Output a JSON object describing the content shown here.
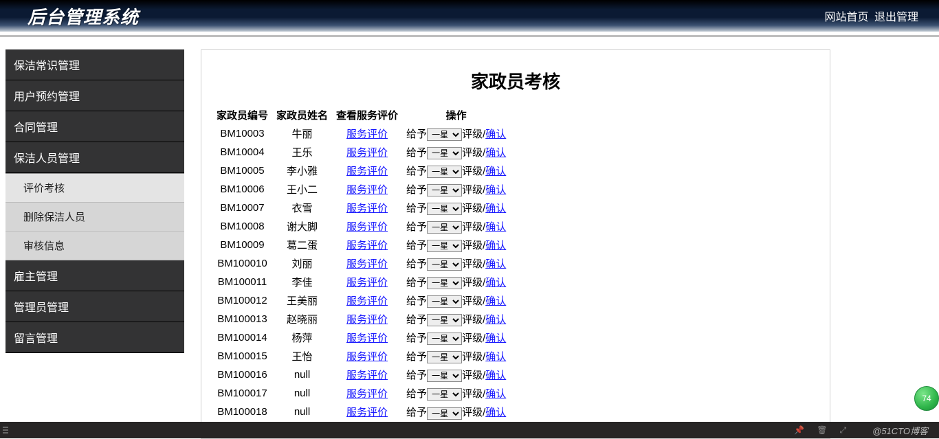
{
  "header": {
    "title": "后台管理系统"
  },
  "header_links": {
    "home": "网站首页",
    "logout": "退出管理"
  },
  "sidebar": {
    "items": [
      {
        "label": "保洁常识管理"
      },
      {
        "label": "用户预约管理"
      },
      {
        "label": "合同管理"
      },
      {
        "label": "保洁人员管理",
        "children": [
          {
            "label": "评价考核",
            "active": true
          },
          {
            "label": "删除保洁人员"
          },
          {
            "label": "审核信息"
          }
        ]
      },
      {
        "label": "雇主管理"
      },
      {
        "label": "管理员管理"
      },
      {
        "label": "留言管理"
      }
    ]
  },
  "page": {
    "title": "家政员考核",
    "columns": {
      "id": "家政员编号",
      "name": "家政员姓名",
      "review": "查看服务评价",
      "op": "操作"
    },
    "review_link_text": "服务评价",
    "op_prefix": "给予",
    "op_select_default": "一星",
    "op_suffix": "评级/",
    "op_confirm": "确认",
    "rows": [
      {
        "id": "BM10003",
        "name": "牛丽"
      },
      {
        "id": "BM10004",
        "name": "王乐"
      },
      {
        "id": "BM10005",
        "name": "李小雅"
      },
      {
        "id": "BM10006",
        "name": "王小二"
      },
      {
        "id": "BM10007",
        "name": "衣雪"
      },
      {
        "id": "BM10008",
        "name": "谢大脚"
      },
      {
        "id": "BM10009",
        "name": "葛二蛋"
      },
      {
        "id": "BM100010",
        "name": "刘丽"
      },
      {
        "id": "BM100011",
        "name": "李佳"
      },
      {
        "id": "BM100012",
        "name": "王美丽"
      },
      {
        "id": "BM100013",
        "name": "赵晓丽"
      },
      {
        "id": "BM100014",
        "name": "杨萍"
      },
      {
        "id": "BM100015",
        "name": "王怡"
      },
      {
        "id": "BM100016",
        "name": "null"
      },
      {
        "id": "BM100017",
        "name": "null"
      },
      {
        "id": "BM100018",
        "name": "null"
      }
    ]
  },
  "float_badge": "74",
  "footer": {
    "brand": "@51CTO博客"
  }
}
